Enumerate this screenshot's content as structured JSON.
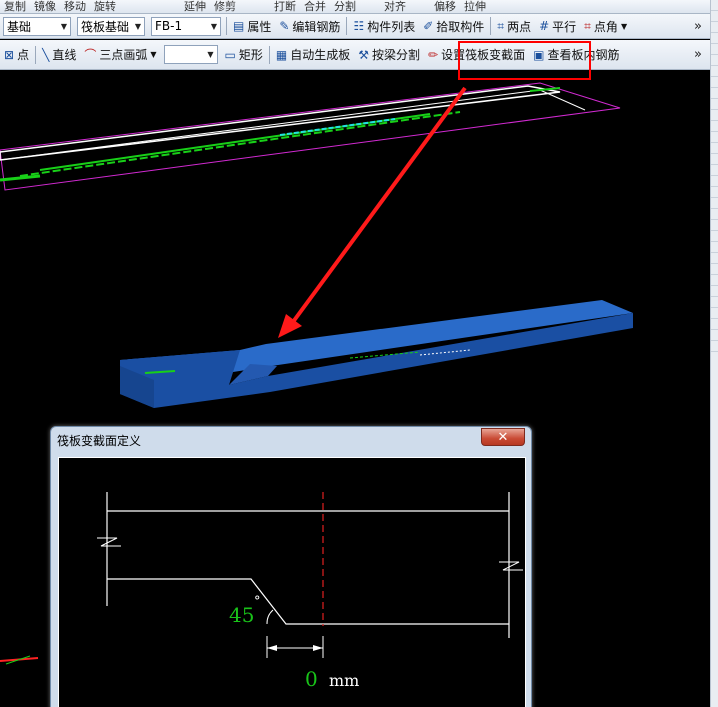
{
  "toolbar_top_partial": [
    "复制",
    "镜像",
    "移动",
    "旋转",
    "延伸",
    "修剪",
    "打断",
    "合并",
    "分割",
    "对齐",
    "偏移",
    "拉伸"
  ],
  "toolbar1": {
    "floor_select": "基础",
    "type_select": "筏板基础",
    "member_select": "FB-1",
    "properties": "属性",
    "edit_rebar": "编辑钢筋",
    "member_list": "构件列表",
    "pick_member": "拾取构件",
    "two_points": "两点",
    "parallel": "平行",
    "point_angle": "点角",
    "more": "»"
  },
  "toolbar2": {
    "point": "点",
    "line": "直线",
    "three_point_arc": "三点画弧",
    "rect": "矩形",
    "auto_gen": "自动生成板",
    "split_by_beam": "按梁分割",
    "set_section": "设置筏板变截面",
    "view_rebar": "查看板内钢筋",
    "more": "»"
  },
  "dialog": {
    "title": "筏板变截面定义",
    "close": "✕",
    "angle_value": "45",
    "degree": "°",
    "offset_value": "0",
    "unit": "mm"
  },
  "colors": {
    "highlight": "#ff0000",
    "slab_blue": "#1f5bb6",
    "green_dim": "#19c319"
  }
}
